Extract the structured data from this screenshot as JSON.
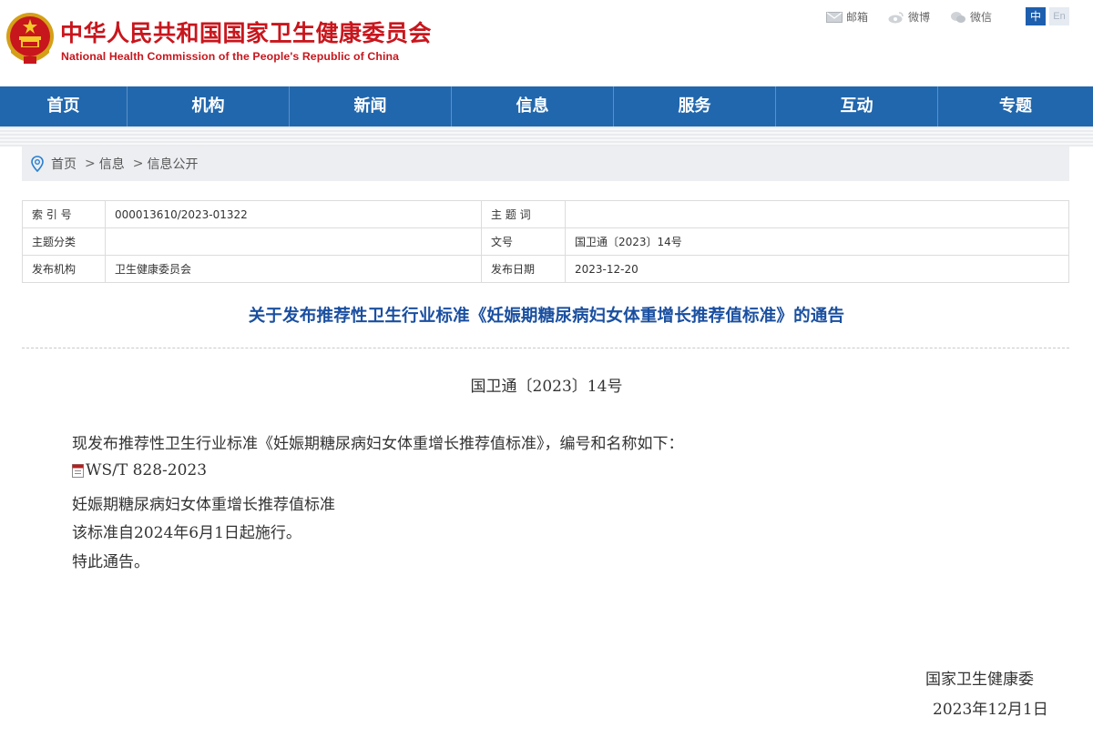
{
  "header": {
    "title_cn": "中华人民共和国国家卫生健康委员会",
    "title_en": "National Health Commission of the People's Republic of China",
    "links": [
      {
        "label": "邮箱",
        "icon": "mail-icon"
      },
      {
        "label": "微博",
        "icon": "weibo-icon"
      },
      {
        "label": "微信",
        "icon": "wechat-icon"
      }
    ],
    "lang_zh": "中",
    "lang_en": "En"
  },
  "nav": {
    "items": [
      "首页",
      "机构",
      "新闻",
      "信息",
      "服务",
      "互动",
      "专题"
    ]
  },
  "breadcrumb": {
    "items": [
      "首页",
      "信息",
      "信息公开"
    ],
    "separator": ">"
  },
  "meta": {
    "index_label": "索 引 号",
    "index_value": "000013610/2023-01322",
    "subject_label": "主 题 词",
    "subject_value": "",
    "category_label": "主题分类",
    "category_value": "",
    "docno_label": "文号",
    "docno_value": "国卫通〔2023〕14号",
    "publisher_label": "发布机构",
    "publisher_value": "卫生健康委员会",
    "date_label": "发布日期",
    "date_value": "2023-12-20"
  },
  "article": {
    "title": "关于发布推荐性卫生行业标准《妊娠期糖尿病妇女体重增长推荐值标准》的通告",
    "doc_no": "国卫通〔2023〕14号",
    "intro": "现发布推荐性卫生行业标准《妊娠期糖尿病妇女体重增长推荐值标准》，编号和名称如下：",
    "standard_code": "WS/T 828-2023",
    "standard_name": "妊娠期糖尿病妇女体重增长推荐值标准",
    "effective": "该标准自2024年6月1日起施行。",
    "closing": "特此通告。",
    "signature": "国家卫生健康委",
    "sign_date": "2023年12月1日"
  },
  "colors": {
    "brand_red": "#c8161d",
    "nav_blue": "#2167ad",
    "title_blue": "#1a4fa0"
  }
}
